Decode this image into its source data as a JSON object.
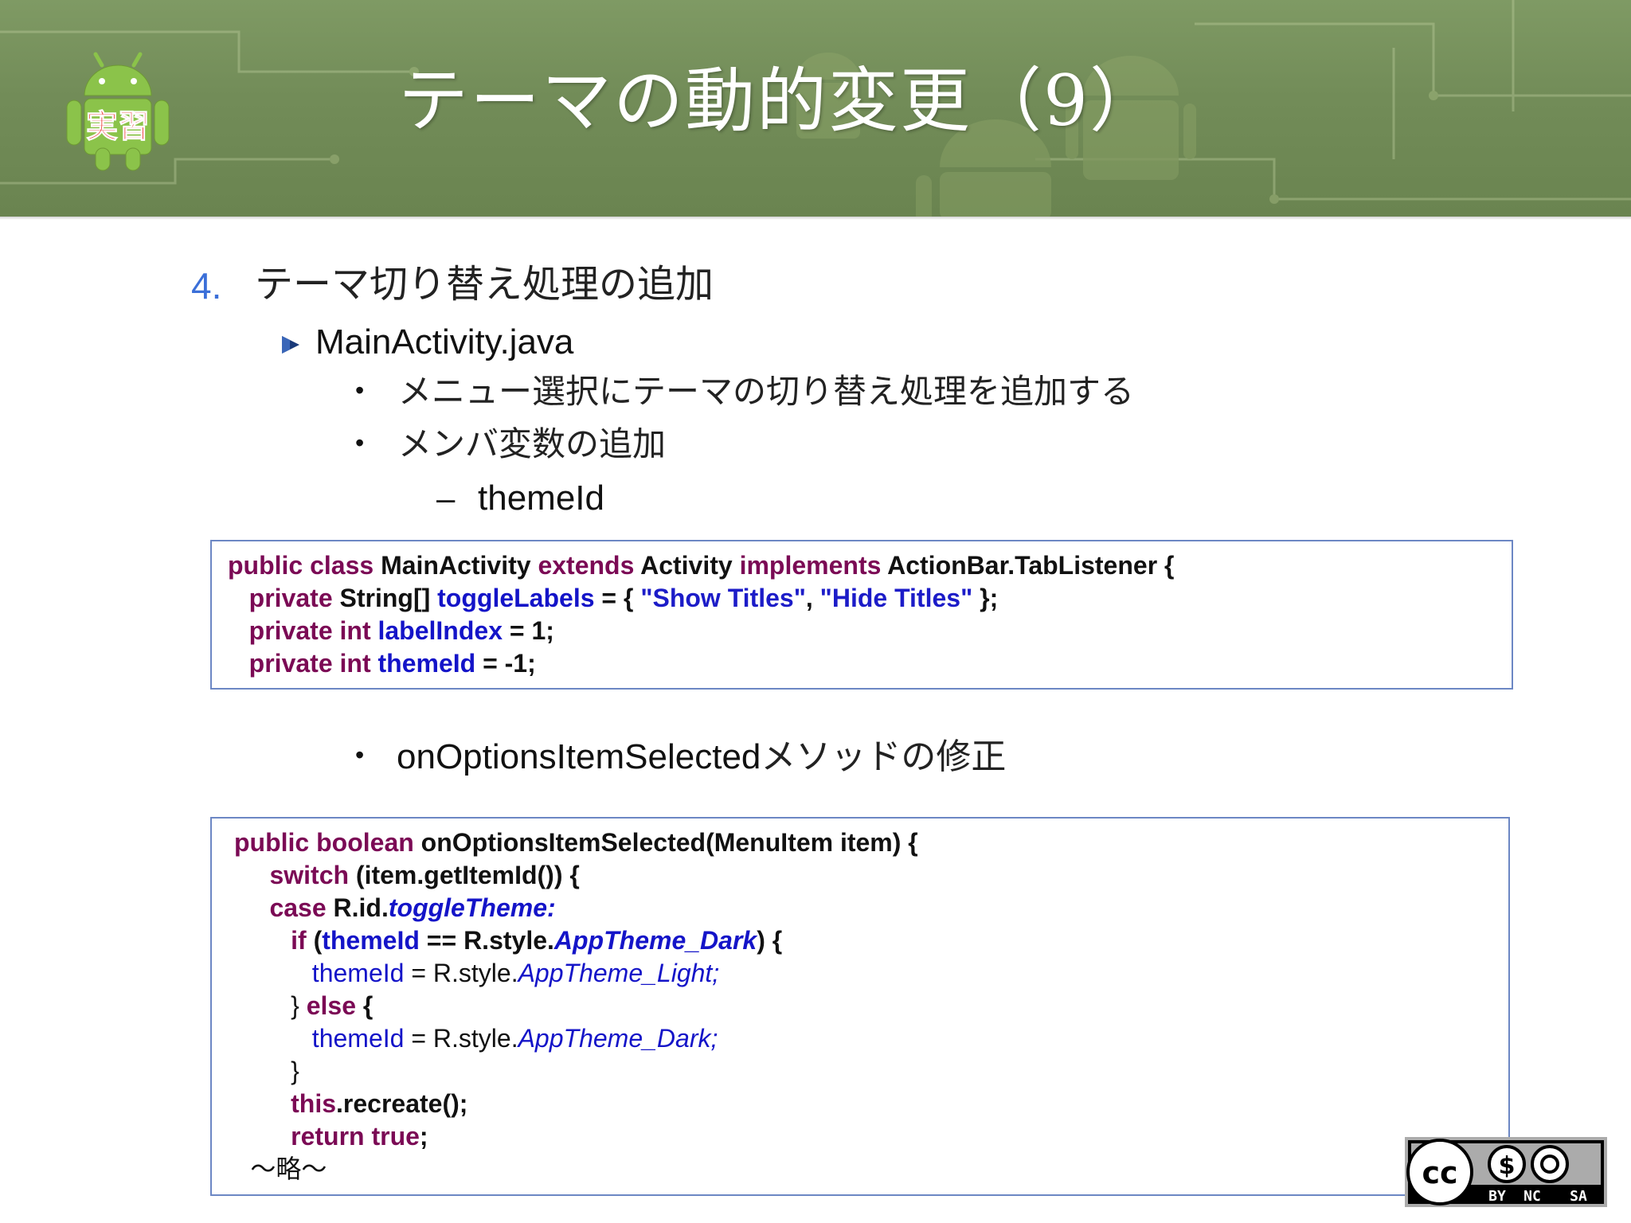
{
  "header": {
    "title": "テーマの動的変更（9）",
    "logo_text": "実習"
  },
  "outline": {
    "item4": {
      "number": "4.",
      "text": "テーマ切り替え処理の追加"
    },
    "file": "MainActivity.java",
    "bullets": [
      "メニュー選択にテーマの切り替え処理を追加する",
      "メンバ変数の追加"
    ],
    "dash_mark": "–",
    "dash_item": "themeId",
    "bullet3": {
      "code_part": "onOptionsItemSelected",
      "jp_part": "メソッドの修正"
    },
    "bullet_char": "•"
  },
  "code_block_1": {
    "lines": [
      [
        {
          "t": "public class ",
          "s": "kw"
        },
        {
          "t": "MainActivity ",
          "s": "pl"
        },
        {
          "t": "extends ",
          "s": "kw"
        },
        {
          "t": "Activity ",
          "s": "pl"
        },
        {
          "t": "implements ",
          "s": "kw"
        },
        {
          "t": "ActionBar.TabListener {",
          "s": "pl"
        }
      ],
      [
        {
          "t": "   private ",
          "s": "kw"
        },
        {
          "t": "String[] ",
          "s": "pl"
        },
        {
          "t": "toggleLabels",
          "s": "fld"
        },
        {
          "t": " = { ",
          "s": "pl"
        },
        {
          "t": "\"Show Titles\"",
          "s": "str"
        },
        {
          "t": ", ",
          "s": "pl"
        },
        {
          "t": "\"Hide Titles\"",
          "s": "str"
        },
        {
          "t": " };",
          "s": "pl"
        }
      ],
      [
        {
          "t": "   private int ",
          "s": "kw"
        },
        {
          "t": "labelIndex",
          "s": "fld"
        },
        {
          "t": " = 1;",
          "s": "pl"
        }
      ],
      [
        {
          "t": "   private int ",
          "s": "kw"
        },
        {
          "t": "themeId",
          "s": "fld"
        },
        {
          "t": " = -1;",
          "s": "pl"
        }
      ]
    ]
  },
  "code_block_2": {
    "lines": [
      [
        {
          "t": "public boolean ",
          "s": "kw"
        },
        {
          "t": "onOptionsItemSelected(MenuItem item) {",
          "s": "pl"
        }
      ],
      [
        {
          "t": "     switch ",
          "s": "kw"
        },
        {
          "t": "(item.getItemId()) {",
          "s": "pl"
        }
      ],
      [
        {
          "t": "     case ",
          "s": "kw"
        },
        {
          "t": "R.id.",
          "s": "pl"
        },
        {
          "t": "toggleTheme:",
          "s": "it"
        }
      ],
      [
        {
          "t": "        if ",
          "s": "kw"
        },
        {
          "t": "(",
          "s": "pl"
        },
        {
          "t": "themeId",
          "s": "fld"
        },
        {
          "t": " == R.style.",
          "s": "pl"
        },
        {
          "t": "AppTheme_Dark",
          "s": "it"
        },
        {
          "t": ") {",
          "s": "pl"
        }
      ],
      [
        {
          "t": "           themeId",
          "s": "fldn"
        },
        {
          "t": " = R.style.",
          "s": "pln"
        },
        {
          "t": "AppTheme_Light;",
          "s": "itn"
        }
      ],
      [
        {
          "t": "        } ",
          "s": "pln"
        },
        {
          "t": "else ",
          "s": "kw"
        },
        {
          "t": "{",
          "s": "pl"
        }
      ],
      [
        {
          "t": "           themeId",
          "s": "fldn"
        },
        {
          "t": " = R.style.",
          "s": "pln"
        },
        {
          "t": "AppTheme_Dark;",
          "s": "itn"
        }
      ],
      [
        {
          "t": "        }",
          "s": "pln"
        }
      ],
      [
        {
          "t": "        this",
          "s": "kw"
        },
        {
          "t": ".recreate();",
          "s": "pl"
        }
      ],
      [
        {
          "t": "        return true",
          "s": "kw"
        },
        {
          "t": ";",
          "s": "pl"
        }
      ],
      [
        {
          "t": "  〜略〜",
          "s": "jpn"
        }
      ]
    ]
  },
  "license": {
    "badge_labels": [
      "BY",
      "NC",
      "SA"
    ]
  },
  "colors": {
    "header_bg": "#728c58",
    "keyword": "#7b0a55",
    "field": "#1414c8",
    "code_border": "#6c87c4",
    "list_number": "#3b6fd8"
  }
}
